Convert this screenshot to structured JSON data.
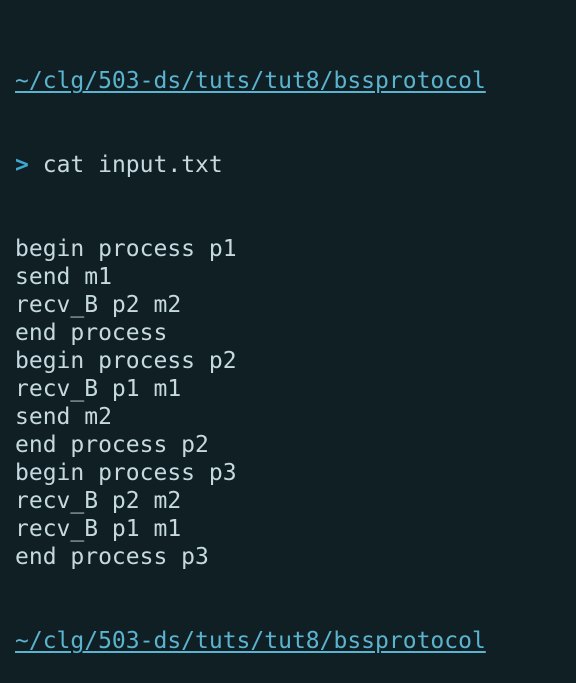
{
  "prompt": {
    "path": "~/clg/503-ds/tuts/tut8/bssprotocol",
    "symbol": ">",
    "command": "cat input.txt"
  },
  "output_lines": [
    "begin process p1",
    "send m1",
    "recv_B p2 m2",
    "end process",
    "begin process p2",
    "recv_B p1 m1",
    "send m2",
    "end process p2",
    "begin process p3",
    "recv_B p2 m2",
    "recv_B p1 m1",
    "end process p3"
  ],
  "next_prompt": {
    "path": "~/clg/503-ds/tuts/tut8/bssprotocol"
  }
}
